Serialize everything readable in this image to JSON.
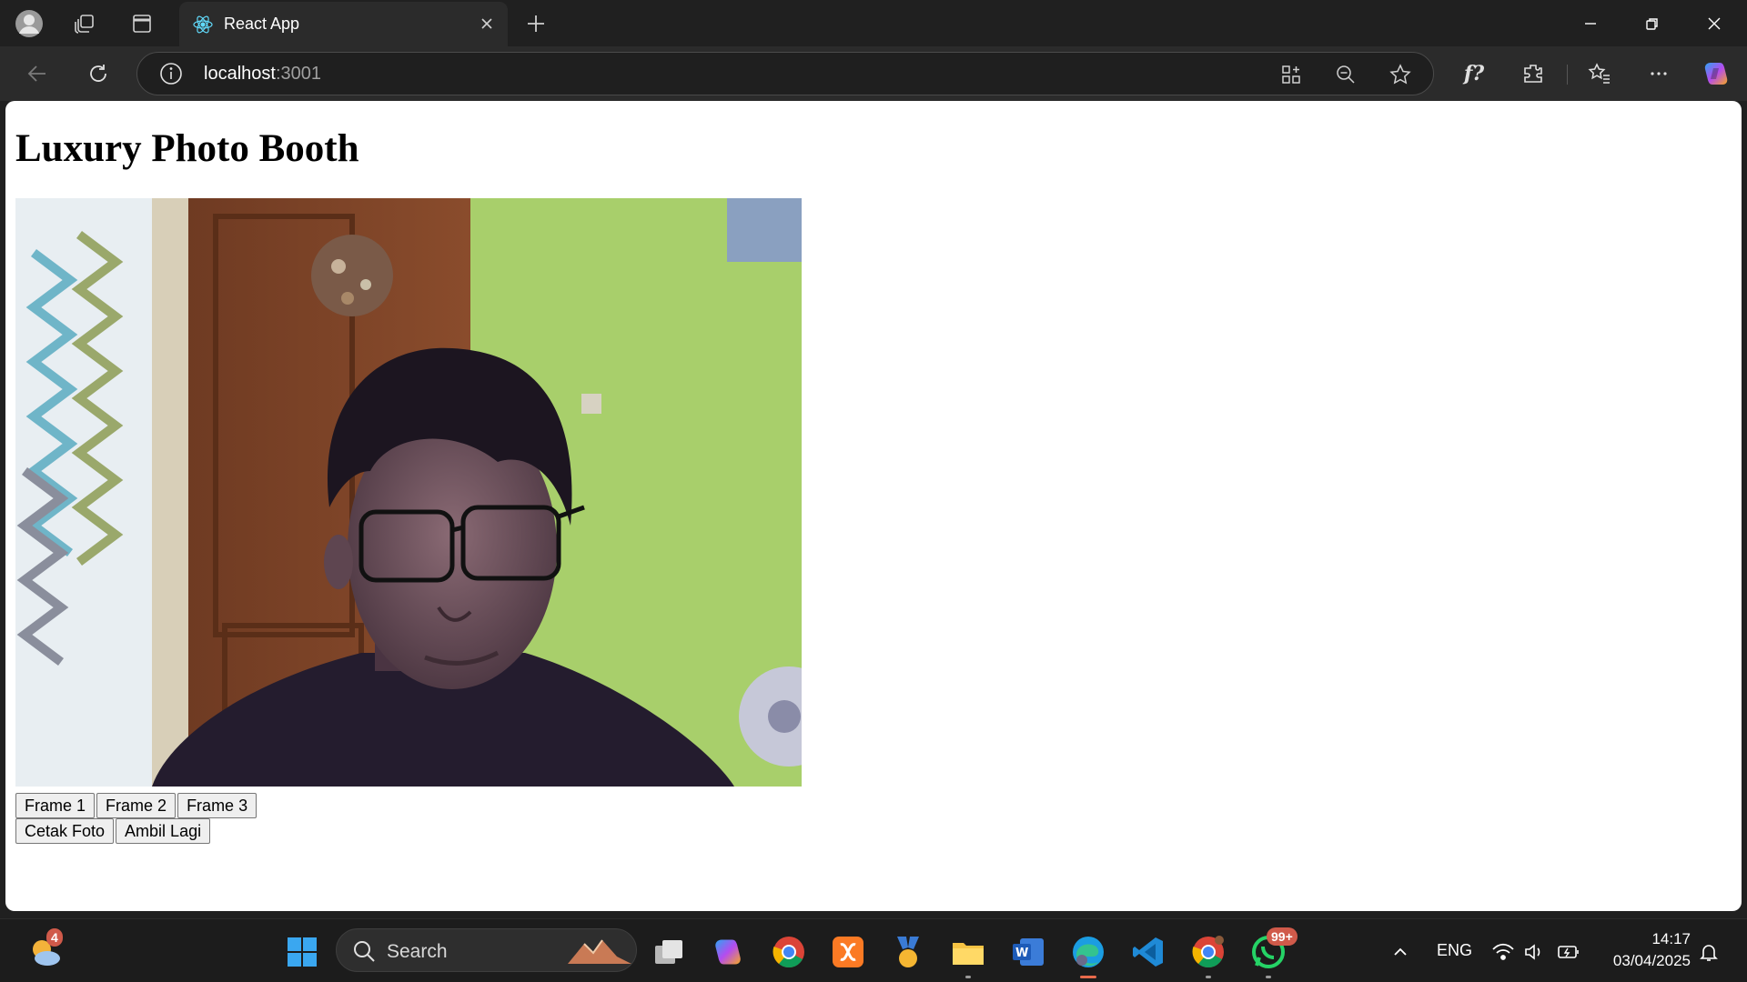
{
  "browser": {
    "tab_title": "React App",
    "url_host": "localhost",
    "url_port": ":3001"
  },
  "page": {
    "title": "Luxury Photo Booth",
    "frame_buttons": [
      "Frame 1",
      "Frame 2",
      "Frame 3"
    ],
    "action_buttons": [
      "Cetak Foto",
      "Ambil Lagi"
    ]
  },
  "taskbar": {
    "weather_badge": "4",
    "search_placeholder": "Search",
    "whatsapp_badge": "99+",
    "language": "ENG",
    "time": "14:17",
    "date": "03/04/2025"
  },
  "colors": {
    "chrome_bg": "#202020",
    "toolbar_bg": "#2b2b2b",
    "page_bg": "#ffffff",
    "badge": "#d05a4a"
  }
}
